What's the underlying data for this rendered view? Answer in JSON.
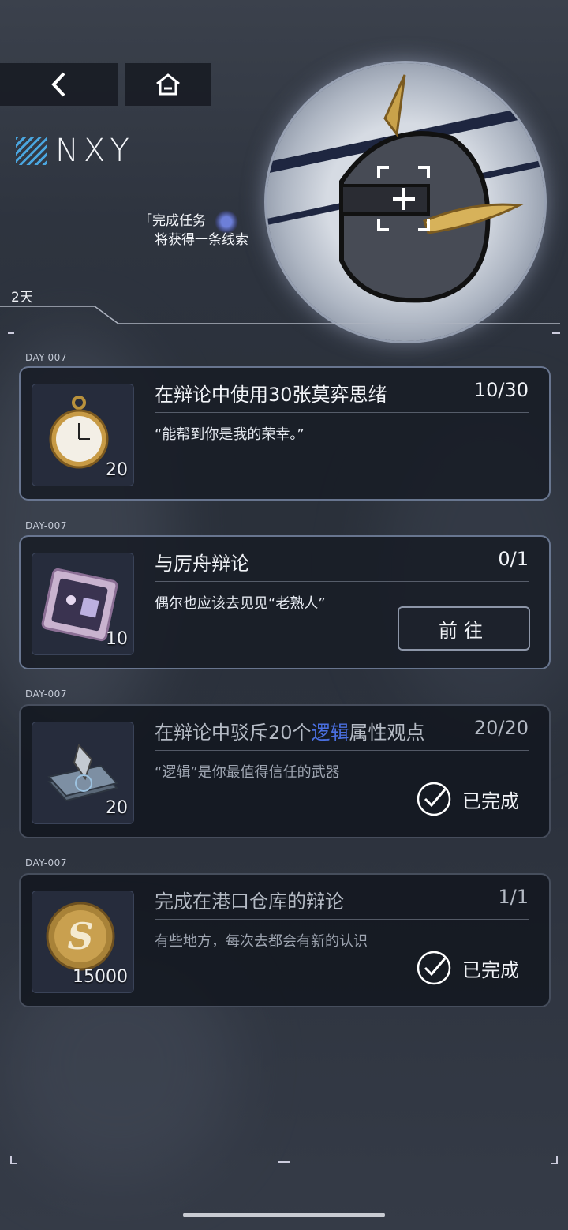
{
  "header": {
    "logo_text": "NXY",
    "hint_line1": "「完成任务",
    "hint_line2": "将获得一条线索",
    "days_left": "2天"
  },
  "tasks": [
    {
      "day": "DAY-007",
      "title": "在辩论中使用30张莫弈思绪",
      "progress": "10/30",
      "desc": "“能帮到你是我的荣幸。”",
      "reward_count": "20",
      "status": "active",
      "reward_icon": "pocket-watch-icon"
    },
    {
      "day": "DAY-007",
      "title": "与厉舟辩论",
      "progress": "0/1",
      "desc": "偶尔也应该去见见“老熟人”",
      "reward_count": "10",
      "status": "goto",
      "button_label": "前往",
      "reward_icon": "chip-card-icon"
    },
    {
      "day": "DAY-007",
      "title_pre": "在辩论中驳斥20个",
      "title_hl": "逻辑",
      "title_post": "属性观点",
      "progress": "20/20",
      "desc": "“逻辑”是你最值得信任的武器",
      "reward_count": "20",
      "status": "done",
      "done_label": "已完成",
      "reward_icon": "logic-card-icon"
    },
    {
      "day": "DAY-007",
      "title": "完成在港口仓库的辩论",
      "progress": "1/1",
      "desc": "有些地方，每次去都会有新的认识",
      "reward_count": "15000",
      "status": "done",
      "done_label": "已完成",
      "reward_icon": "coin-icon"
    }
  ],
  "colors": {
    "accent": "#4a6fe0",
    "border_active": "#aabee6"
  }
}
